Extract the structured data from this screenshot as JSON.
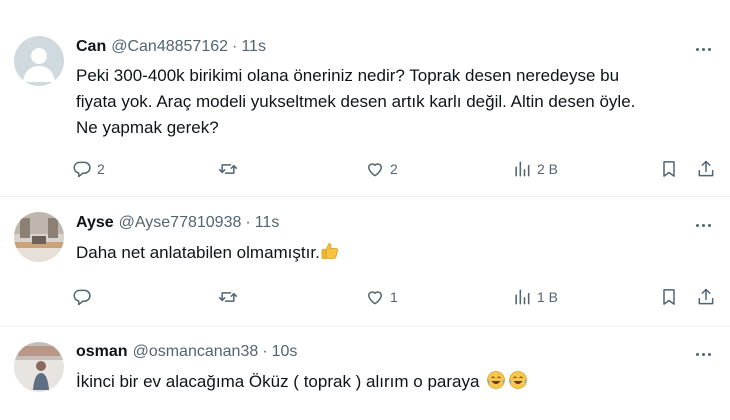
{
  "tweets": [
    {
      "name": "Can",
      "handle": "@Can48857162",
      "separator": "·",
      "time": "11s",
      "text_lines": [
        "Peki 300-400k birikimi olana öneriniz nedir? Toprak desen neredeyse bu",
        "fiyata yok. Araç modeli yukseltmek desen artık karlı değil. Altin desen öyle.",
        "Ne yapmak gerek?"
      ],
      "replies": "2",
      "retweets": "",
      "likes": "2",
      "views": "2 B",
      "avatar_icon": "default-avatar-icon"
    },
    {
      "name": "Ayse",
      "handle": "@Ayse77810938",
      "separator": "·",
      "time": "11s",
      "text": "Daha net anlatabilen olmamıştır.",
      "emoji": "thumbs-up-emoji",
      "replies": "",
      "retweets": "",
      "likes": "1",
      "views": "1 B",
      "avatar_icon": "room-photo-avatar"
    },
    {
      "name": "osman",
      "handle": "@osmancanan38",
      "separator": "·",
      "time": "10s",
      "text": "İkinci bir ev alacağıma Öküz ( toprak ) alırım o paraya",
      "emoji": "tears-of-joy-emoji",
      "avatar_icon": "person-photo-avatar"
    }
  ],
  "colors": {
    "text": "#0f1419",
    "secondary": "#536471",
    "divider": "#eff3f4"
  }
}
